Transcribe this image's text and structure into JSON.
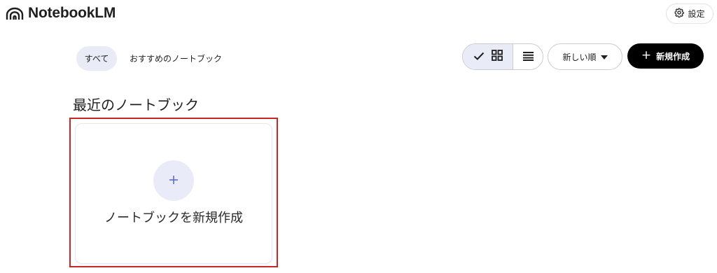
{
  "header": {
    "app_name": "NotebookLM",
    "settings_label": "設定"
  },
  "filters": {
    "all_label": "すべて",
    "recommended_label": "おすすめのノートブック"
  },
  "toolbar": {
    "view_mode": "grid",
    "sort_label": "新しい順",
    "new_label": "新規作成"
  },
  "main": {
    "section_title": "最近のノートブック",
    "create_card_label": "ノートブックを新規作成"
  },
  "colors": {
    "accent_soft": "#e9ecf6",
    "plus_icon": "#5b6ccf",
    "primary_button": "#000000",
    "highlight_frame": "#c62828"
  }
}
